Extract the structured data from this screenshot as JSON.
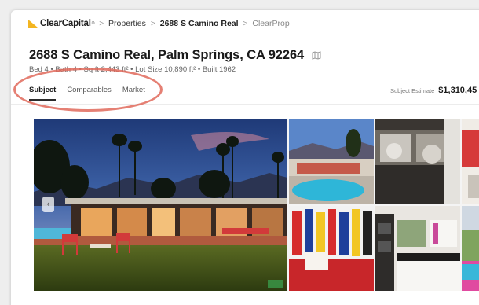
{
  "breadcrumb": {
    "brand": "ClearCapital",
    "brand_mark": "®",
    "separator": ">",
    "items": [
      "Properties",
      "2688 S Camino Real",
      "ClearProp"
    ]
  },
  "property": {
    "address": "2688 S Camino Real, Palm Springs, CA 92264",
    "meta": "Bed 4  •  Bath 4  •  Sq ft 2,443 ft²  •  Lot Size 10,890 ft²  •  Built 1962"
  },
  "tabs": [
    {
      "label": "Subject",
      "active": true
    },
    {
      "label": "Comparables",
      "active": false
    },
    {
      "label": "Market",
      "active": false
    }
  ],
  "estimate": {
    "label": "Subject Estimate",
    "value": "$1,310,45"
  },
  "gallery": {
    "prev_arrow": "‹"
  },
  "colors": {
    "annotation": "#e06a5c",
    "brand_yellow": "#f3b521"
  },
  "icons": [
    "map-icon",
    "chevron-left-icon"
  ]
}
